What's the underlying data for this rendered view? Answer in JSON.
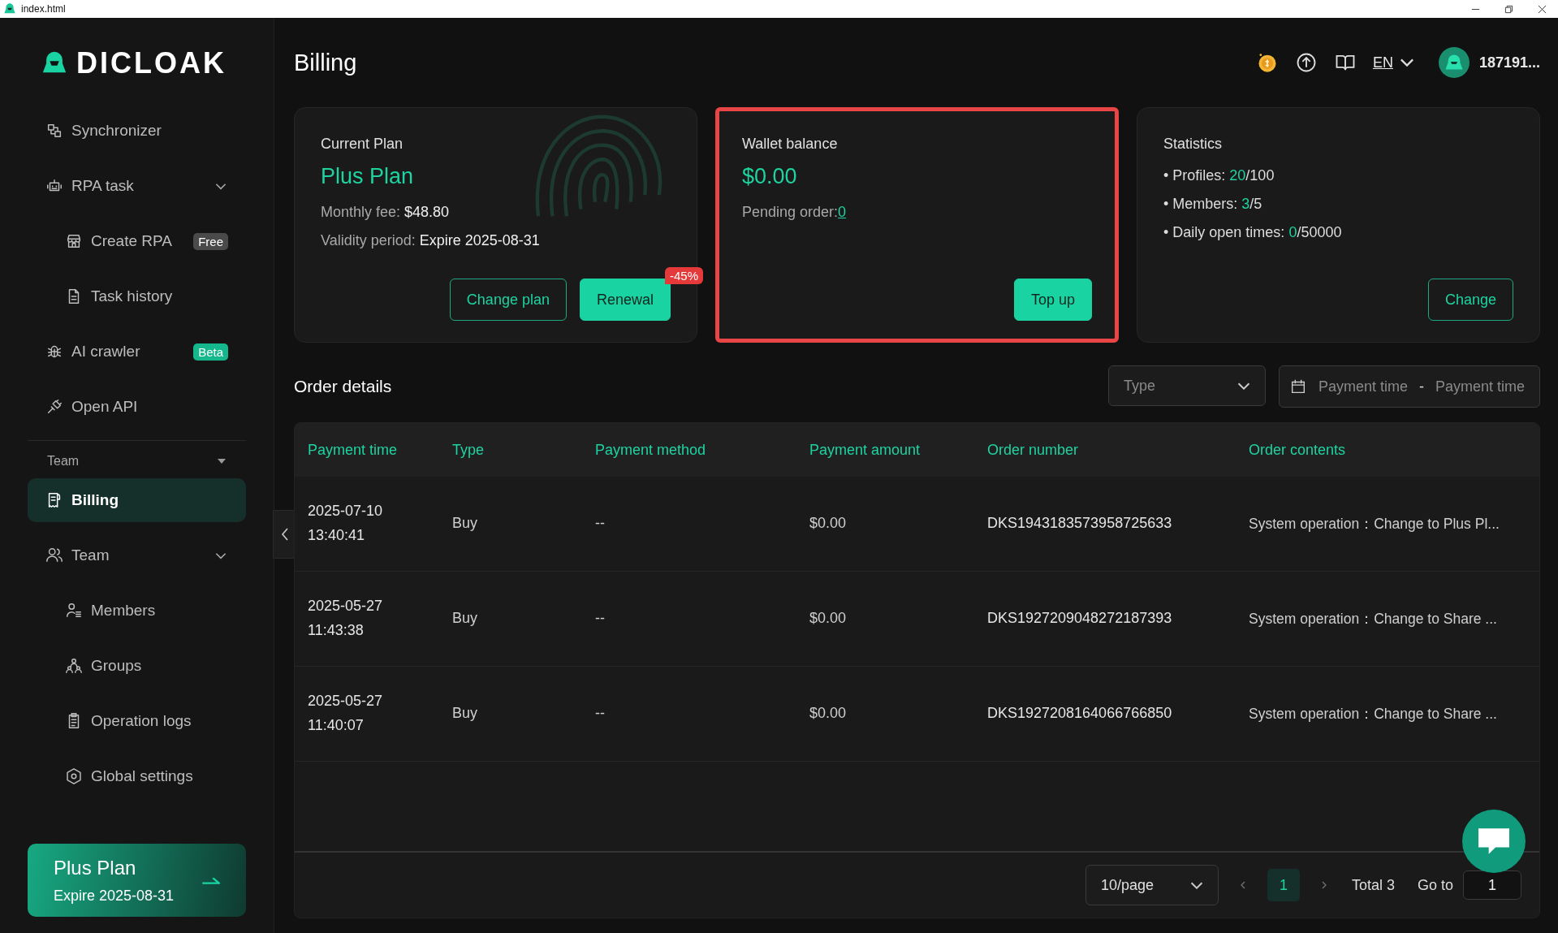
{
  "window": {
    "title": "index.html"
  },
  "sidebar": {
    "logo": "DICLOAK",
    "nav": [
      {
        "label": "Synchronizer",
        "selected": false
      },
      {
        "label": "RPA task",
        "selected": false,
        "expanded": true,
        "children": [
          {
            "label": "Create RPA",
            "selected": false,
            "badge": {
              "text": "Free",
              "color": "#4a4a4a"
            }
          },
          {
            "label": "Task history",
            "selected": false
          }
        ]
      },
      {
        "label": "AI crawler",
        "selected": false,
        "badge": {
          "text": "Beta",
          "color": "#15b88c"
        }
      },
      {
        "label": "Open API",
        "selected": false
      }
    ],
    "section": {
      "label": "Team",
      "expanded": true
    },
    "team_nav": [
      {
        "label": "Billing",
        "selected": true
      },
      {
        "label": "Team",
        "selected": false,
        "expanded": true,
        "children": [
          {
            "label": "Members",
            "selected": false
          },
          {
            "label": "Groups",
            "selected": false
          },
          {
            "label": "Operation logs",
            "selected": false
          },
          {
            "label": "Global settings",
            "selected": false
          }
        ]
      }
    ],
    "plan_card": {
      "name": "Plus Plan",
      "expiry": "Expire 2025-08-31"
    }
  },
  "header": {
    "title": "Billing",
    "language": "EN",
    "username": "187191..."
  },
  "cards": [
    {
      "kind": "plan",
      "highlighted": false,
      "title": "Current Plan",
      "plan": "Plus Plan",
      "fields": [
        {
          "label": "Monthly fee:",
          "value": "$48.80"
        },
        {
          "label": "Validity period:",
          "value": "Expire 2025-08-31"
        }
      ],
      "buttons": [
        {
          "label": "Change plan",
          "primary": false
        },
        {
          "label": "Renewal",
          "primary": true,
          "badge": "-45%"
        }
      ]
    },
    {
      "kind": "wallet",
      "highlighted": true,
      "title": "Wallet balance",
      "balance": "$0.00",
      "pending_label": "Pending order:",
      "pending_value": "0",
      "buttons": [
        {
          "label": "Top up",
          "primary": true
        }
      ]
    },
    {
      "kind": "stats",
      "highlighted": false,
      "title": "Statistics",
      "items": [
        {
          "label": "• Profiles:",
          "used": "20",
          "limit": "/100"
        },
        {
          "label": "• Members:",
          "used": "3",
          "limit": "/5"
        },
        {
          "label": "• Daily open times:",
          "used": "0",
          "limit": "/50000"
        }
      ],
      "buttons": [
        {
          "label": "Change",
          "primary": false
        }
      ]
    }
  ],
  "orders": {
    "title": "Order details",
    "type_filter": {
      "placeholder": "Type"
    },
    "date_range": {
      "start_placeholder": "Payment time",
      "separator": "-",
      "end_placeholder": "Payment time"
    },
    "table": {
      "columns": [
        "Payment time",
        "Type",
        "Payment method",
        "Payment amount",
        "Order number",
        "Order contents"
      ],
      "rows": [
        [
          "2025-07-10 13:40:41",
          "Buy",
          "--",
          "$0.00",
          "DKS1943183573958725633",
          "System operation：Change to Plus Pl..."
        ],
        [
          "2025-05-27 11:43:38",
          "Buy",
          "--",
          "$0.00",
          "DKS1927209048272187393",
          "System operation：Change to Share ..."
        ],
        [
          "2025-05-27 11:40:07",
          "Buy",
          "--",
          "$0.00",
          "DKS1927208164066766850",
          "System operation：Change to Share ..."
        ]
      ]
    },
    "pagination": {
      "page_size": "10/page",
      "pages": [
        {
          "label": "1",
          "selected": true
        }
      ],
      "total": "Total 3",
      "goto_label": "Go to",
      "goto_value": "1"
    }
  }
}
